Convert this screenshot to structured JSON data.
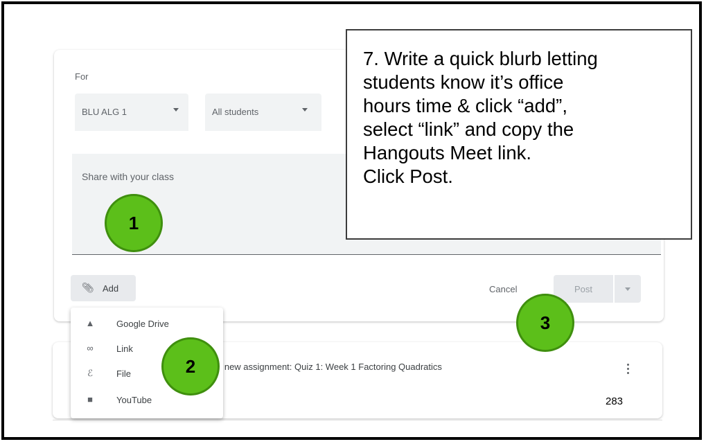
{
  "form": {
    "for_label": "For",
    "class_select": "BLU ALG 1",
    "students_select": "All students",
    "share_placeholder": "Share with your class",
    "add_label": "Add",
    "cancel_label": "Cancel",
    "post_label": "Post"
  },
  "add_menu": {
    "items": [
      {
        "label": "Google Drive",
        "icon": "google-drive-icon"
      },
      {
        "label": "Link",
        "icon": "link-icon"
      },
      {
        "label": "File",
        "icon": "paperclip-icon"
      },
      {
        "label": "YouTube",
        "icon": "youtube-icon"
      }
    ]
  },
  "stream": {
    "assignment_text": "a new assignment: Quiz 1: Week 1 Factoring Quadratics"
  },
  "callout": {
    "text": "7. Write a quick blurb letting\nstudents know it’s office\nhours time & click “add”,\nselect “link” and copy the\nHangouts Meet link.\nClick Post."
  },
  "steps": [
    "1",
    "2",
    "3"
  ],
  "page_number": "283",
  "colors": {
    "badge": "#5cbf1a",
    "surface": "#f1f3f4"
  }
}
